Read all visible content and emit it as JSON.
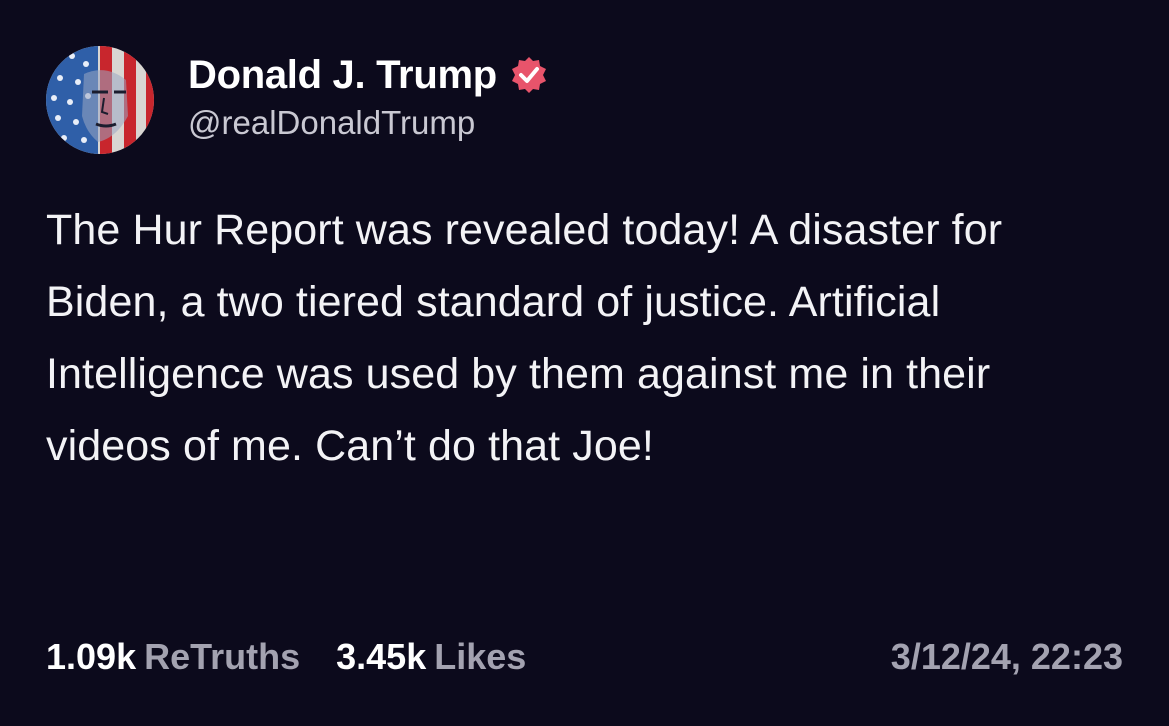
{
  "author": {
    "display_name": "Donald J. Trump",
    "handle": "@realDonaldTrump",
    "avatar_icon": "flag-portrait-avatar",
    "verified_icon": "verified-badge-icon",
    "verified_color": "#e8546b"
  },
  "post": {
    "text": "The Hur Report was revealed today! A disaster for Biden, a two tiered standard of justice. Artificial Intelligence was used by them against me in their videos of me. Can’t do that Joe!"
  },
  "stats": {
    "retruths_count": "1.09k",
    "retruths_label": "ReTruths",
    "likes_count": "3.45k",
    "likes_label": "Likes"
  },
  "timestamp": "3/12/24, 22:23",
  "colors": {
    "background": "#0c0a1c",
    "text": "#f3f3f6",
    "muted": "#a3a2b0"
  }
}
